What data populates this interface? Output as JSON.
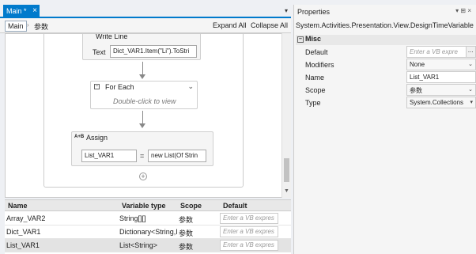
{
  "tab": {
    "label": "Main *",
    "close": "×"
  },
  "breadcrumb": {
    "main": "Main",
    "separator": "›",
    "sub": "参数"
  },
  "toolbar": {
    "expand_all": "Expand All",
    "collapse_all": "Collapse All"
  },
  "write_line": {
    "title": "Write Line",
    "text_label": "Text",
    "text_value": "Dict_VAR1.Item(\"Li\").ToStri"
  },
  "for_each": {
    "title": "For Each",
    "hint": "Double-click to view"
  },
  "assign": {
    "title": "Assign",
    "icon": "A+B",
    "to": "List_VAR1",
    "equals": "=",
    "value": "new List(Of Strin"
  },
  "variables": {
    "headers": [
      "Name",
      "Variable type",
      "Scope",
      "Default"
    ],
    "rows": [
      {
        "name": "Array_VAR2",
        "type": "String[][]",
        "scope": "参数",
        "default": "Enter a VB expres"
      },
      {
        "name": "Dict_VAR1",
        "type": "Dictionary<String,Int",
        "scope": "参数",
        "default": "Enter a VB expres"
      },
      {
        "name": "List_VAR1",
        "type": "List<String>",
        "scope": "参数",
        "default": "Enter a VB expres",
        "selected": true
      }
    ]
  },
  "properties": {
    "title": "Properties",
    "icons": "▾ ⊞ ×",
    "type_name": "System.Activities.Presentation.View.DesignTimeVariable",
    "group": "Misc",
    "rows": [
      {
        "label": "Default",
        "value": "Enter a VB expre",
        "placeholder": true,
        "button": "..."
      },
      {
        "label": "Modifiers",
        "value": "None",
        "dropdown": true
      },
      {
        "label": "Name",
        "value": "List_VAR1"
      },
      {
        "label": "Scope",
        "value": "参数",
        "dropdown": true
      },
      {
        "label": "Type",
        "value": "System.Collections",
        "dropdown": true
      }
    ]
  },
  "colors": {
    "accent": "#007acc",
    "selected_row": "#e3e3e3"
  }
}
